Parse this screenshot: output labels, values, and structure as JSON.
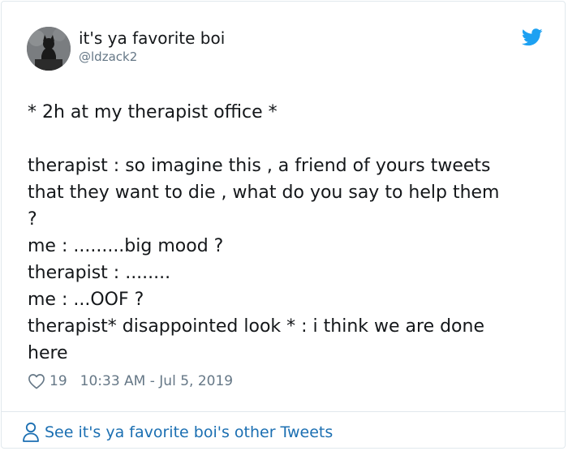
{
  "author": {
    "display_name": "it's ya favorite boi",
    "handle": "@ldzack2"
  },
  "tweet": {
    "lines": [
      "* 2h at my therapist office *",
      "",
      "therapist : so imagine this , a friend of yours tweets",
      "that they want to die , what do you say to help them",
      "?",
      "me : .........big mood ?",
      "therapist : ........",
      "me : ...OOF ?",
      "therapist* disappointed look * : i think we are done",
      "here"
    ],
    "like_count": "19",
    "timestamp": "10:33 AM - Jul 5, 2019"
  },
  "footer": {
    "more_tweets_label": "See it's ya favorite boi's other Tweets"
  },
  "icons": {
    "brand": "twitter-bird-icon",
    "like": "heart-icon",
    "profile": "person-icon"
  },
  "colors": {
    "brand_blue": "#1da1f2",
    "link_blue": "#1b6fb2",
    "secondary_text": "#657786"
  }
}
